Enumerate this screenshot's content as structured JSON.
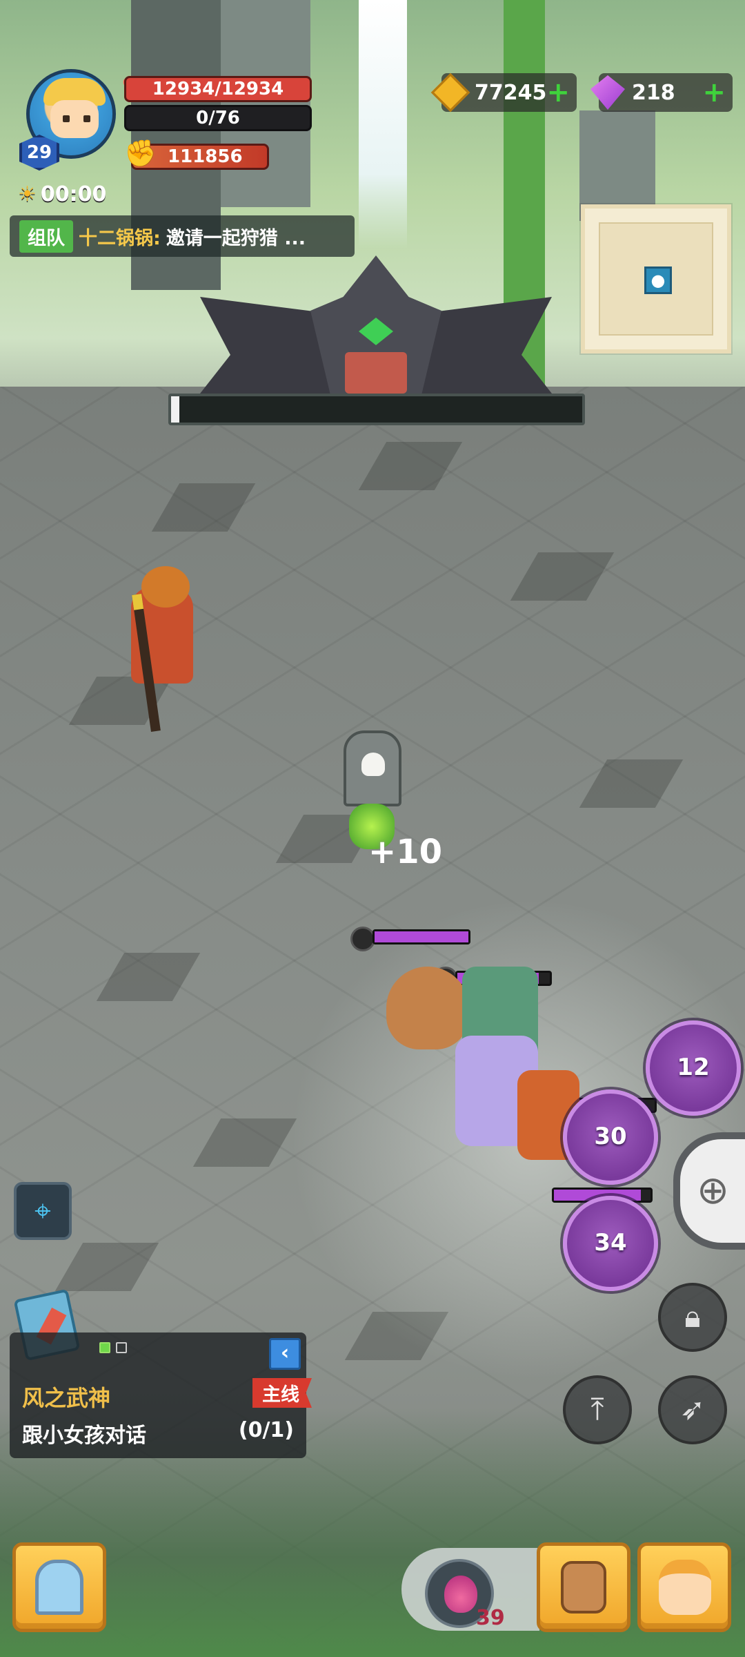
{
  "player": {
    "level": "29",
    "hp": "12934/12934",
    "energy": "0/76",
    "power": "111856",
    "timer": "00:00"
  },
  "team_banner": {
    "tag": "组队",
    "name": "十二锅锅:",
    "message": "邀请一起狩猎 ..."
  },
  "currency": {
    "gold": "77245",
    "gems": "218"
  },
  "combat": {
    "float_text": "+10",
    "boss_hp_fraction": 0.02
  },
  "skills": [
    {
      "cooldown": "12"
    },
    {
      "cooldown": "30"
    },
    {
      "cooldown": "34"
    }
  ],
  "quest": {
    "title": "风之武神",
    "tag": "主线",
    "description": "跟小女孩对话",
    "progress": "(0/1)"
  },
  "items": {
    "potion_count": "39"
  },
  "icons": {
    "gold": "gold-coin-icon",
    "gem": "purple-gem-icon",
    "locate": "location-pin-icon",
    "lock": "lock-icon",
    "jump": "jump-icon",
    "bow": "bow-icon",
    "control": "gamepad-icon"
  },
  "colors": {
    "skill_accent": "#9d5bbd",
    "hp": "#d8443a",
    "quest_title": "#f0bf4a",
    "quest_tag": "#d83a2e"
  }
}
